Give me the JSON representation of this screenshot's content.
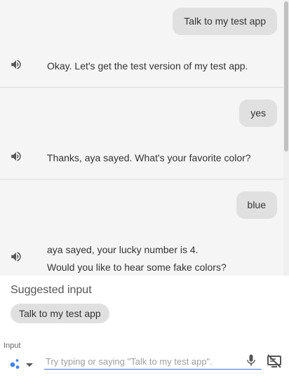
{
  "conversation": {
    "turns": [
      {
        "user": "Talk to my test app",
        "agent_lines": [
          "Okay. Let's get the test version of my test app."
        ],
        "speaker_icon": "speaker-icon"
      },
      {
        "user": "yes",
        "agent_lines": [
          "Thanks, aya sayed. What's your favorite color?"
        ],
        "speaker_icon": "speaker-icon"
      },
      {
        "user": "blue",
        "agent_lines": [
          "aya sayed, your lucky number is 4.",
          "Would you like to hear some fake colors?"
        ],
        "speaker_icon": "speaker-icon"
      }
    ]
  },
  "suggestions": {
    "title": "Suggested input",
    "chips": [
      "Talk to my test app"
    ]
  },
  "input": {
    "label": "Input",
    "placeholder": "Try typing or saying \"Talk to my test app\".",
    "value": "",
    "mode_icon": "assistant-dots-icon",
    "mic_icon": "mic-icon",
    "screen_icon": "no-screen-icon"
  },
  "colors": {
    "conversation_bg": "#f5f5f5",
    "bubble_bg": "#e0e0e0",
    "input_underline": "#3b78e7",
    "assistant_blue": "#4285f4"
  }
}
